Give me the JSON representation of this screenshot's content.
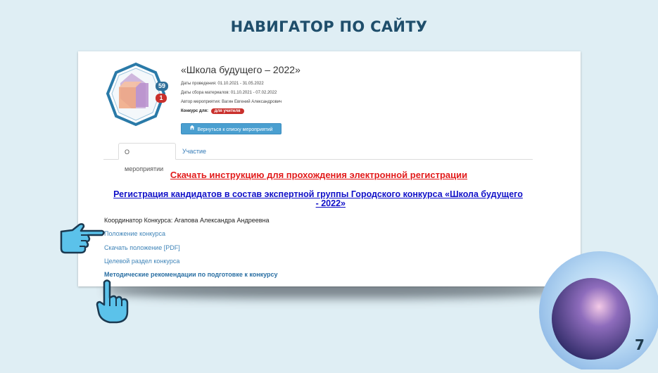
{
  "slide": {
    "title": "НАВИГАТОР ПО САЙТУ",
    "page_number": "7"
  },
  "event": {
    "badge_count_blue": "59",
    "badge_count_red": "1",
    "title": "«Школа будущего – 2022»",
    "dates_held": "Даты проведения: 01.10.2021 - 31.05.2022",
    "dates_collect": "Даты сбора материалов: 01.10.2021 - 07.02.2022",
    "author": "Автор мероприятия: Вагин Евгений Александрович",
    "contest_for_label": "Конкурс для:",
    "contest_for_tag": "для учителя",
    "back_button": "Вернуться к списку мероприятий"
  },
  "tabs": [
    {
      "label": "О мероприятии",
      "active": true
    },
    {
      "label": "Участие",
      "active": false
    }
  ],
  "content": {
    "download_link": "Скачать инструкцию для прохождения электронной регистрации",
    "registration_link_line1": "Регистрация кандидатов в состав экспертной группы Городского конкурса «Школа будущего",
    "registration_link_line2": "- 2022»",
    "coordinator": "Координатор Конкурса: Агапова Александра Андреевна",
    "links": [
      "Положение конкурса",
      "Скачать положение [PDF]",
      "Целевой раздел конкурса",
      "Методические рекомендации по подготовке к конкурсу"
    ]
  },
  "colors": {
    "accent_blue": "#4a9fd0",
    "title_color": "#1f4e6b",
    "link_red": "#e21b1b",
    "link_blue": "#1010c8"
  },
  "icons": [
    "event-badge-icon",
    "home-icon",
    "pointing-hand-right-icon",
    "pointing-hand-up-icon",
    "decorative-ring-icon"
  ]
}
